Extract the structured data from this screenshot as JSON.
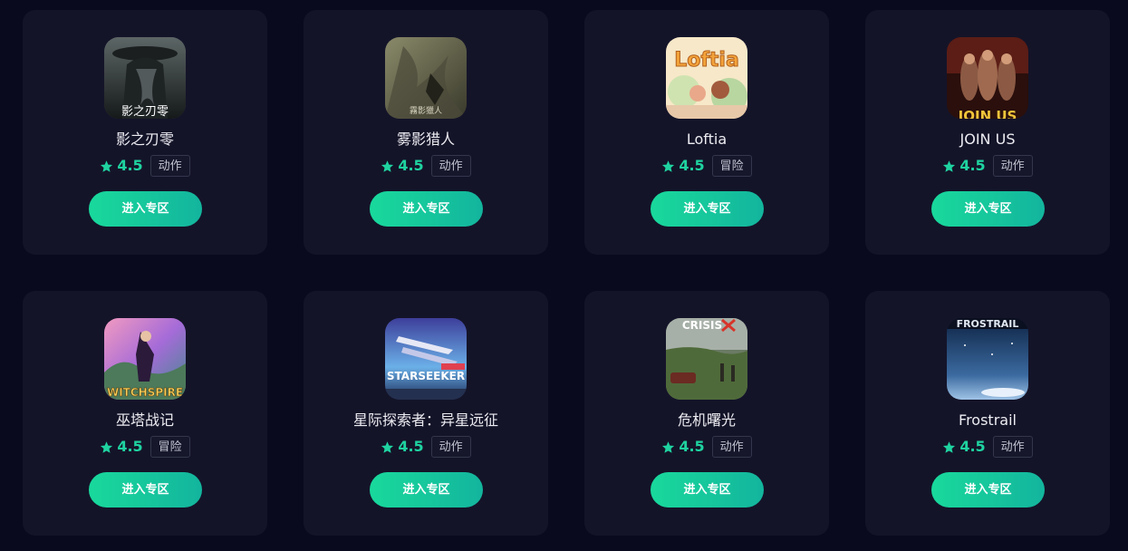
{
  "games": [
    {
      "title": "影之刃零",
      "rating": "4.5",
      "tag": "动作",
      "button": "进入专区",
      "icon": "shadow-blade-zero-cover",
      "cover_text": "影之刃零"
    },
    {
      "title": "雾影猎人",
      "rating": "4.5",
      "tag": "动作",
      "button": "进入专区",
      "icon": "mist-shadow-hunter-cover",
      "cover_text": "雾影猎人"
    },
    {
      "title": "Loftia",
      "rating": "4.5",
      "tag": "冒险",
      "button": "进入专区",
      "icon": "loftia-cover",
      "cover_text": "Loftia"
    },
    {
      "title": "JOIN US",
      "rating": "4.5",
      "tag": "动作",
      "button": "进入专区",
      "icon": "join-us-cover",
      "cover_text": "JOIN US"
    },
    {
      "title": "巫塔战记",
      "rating": "4.5",
      "tag": "冒险",
      "button": "进入专区",
      "icon": "witchspire-cover",
      "cover_text": "WITCHSPIRE"
    },
    {
      "title": "星际探索者：异星远征",
      "rating": "4.5",
      "tag": "动作",
      "button": "进入专区",
      "icon": "starseeker-cover",
      "cover_text": "STARSEEKER"
    },
    {
      "title": "危机曙光",
      "rating": "4.5",
      "tag": "动作",
      "button": "进入专区",
      "icon": "crisis-cover",
      "cover_text": "CRISIS"
    },
    {
      "title": "Frostrail",
      "rating": "4.5",
      "tag": "动作",
      "button": "进入专区",
      "icon": "frostrail-cover",
      "cover_text": "FROSTRAIL"
    }
  ],
  "colors": {
    "background": "#0a0a1e",
    "card": "#141429",
    "accent": "#1fd3a0",
    "button_start": "#19d99c",
    "button_end": "#13b59d"
  }
}
